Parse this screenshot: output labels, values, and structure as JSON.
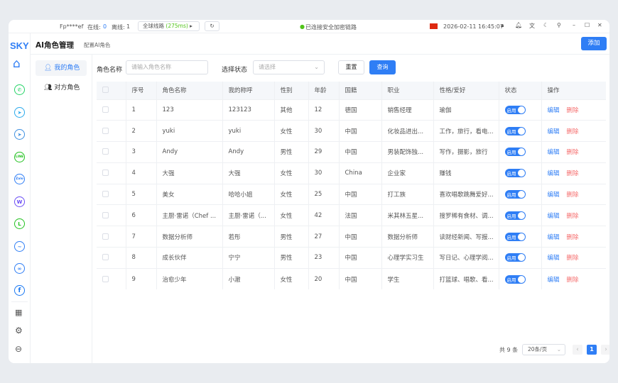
{
  "topbar": {
    "fingerprint": "Fp****ef",
    "online_label": "在线:",
    "online_count": "0",
    "offline_label": "离线:",
    "offline_count": "1",
    "route_label": "全球线路",
    "route_latency": "(275ms)",
    "connection_status": "已连接安全加密链路",
    "datetime": "2026-02-11 16:45:07"
  },
  "sidebar": {
    "logo": "SKY",
    "apps": [
      "home",
      "whatsapp",
      "telegram",
      "telegram-x",
      "line",
      "zalo",
      "w-app",
      "line-lite",
      "messenger",
      "meta",
      "facebook"
    ],
    "bottom": [
      "apps",
      "settings",
      "logout"
    ]
  },
  "header": {
    "title": "AI角色管理",
    "subtitle": "配置AI角色",
    "add_label": "添加"
  },
  "subnav": [
    {
      "label": "我的角色",
      "active": true
    },
    {
      "label": "对方角色",
      "active": false
    }
  ],
  "filters": {
    "name_label": "角色名称",
    "name_placeholder": "请输入角色名称",
    "status_label": "选择状态",
    "status_placeholder": "请选择",
    "reset_label": "重置",
    "query_label": "查询"
  },
  "table": {
    "columns": [
      "序号",
      "角色名称",
      "我的称呼",
      "性别",
      "年龄",
      "国籍",
      "职业",
      "性格/爱好",
      "状态",
      "操作"
    ],
    "rows": [
      [
        "1",
        "123",
        "123123",
        "其他",
        "12",
        "德国",
        "销售经理",
        "瑜伽"
      ],
      [
        "2",
        "yuki",
        "yuki",
        "女性",
        "30",
        "中国",
        "化妆品进出...",
        "工作，旅行，看电..."
      ],
      [
        "3",
        "Andy",
        "Andy",
        "男性",
        "29",
        "中国",
        "男装配饰独...",
        "写作，摄影，旅行"
      ],
      [
        "4",
        "大强",
        "大强",
        "女性",
        "30",
        "China",
        "企业家",
        "赚钱"
      ],
      [
        "5",
        "美女",
        "哈哈小姐",
        "女性",
        "25",
        "中国",
        "打工族",
        "喜欢唱歌跳舞爱好..."
      ],
      [
        "6",
        "主厨·雷诺（Chef ...",
        "主厨·雷诺（...",
        "女性",
        "42",
        "法国",
        "米其林五星...",
        "搜罗稀有食材、调..."
      ],
      [
        "7",
        "数据分析师",
        "若彤",
        "男性",
        "27",
        "中国",
        "数据分析师",
        "读财经新闻、写报..."
      ],
      [
        "8",
        "成长伙伴",
        "宁宁",
        "男性",
        "23",
        "中国",
        "心理学实习生",
        "写日记、心理学阅..."
      ],
      [
        "9",
        "治愈少年",
        "小澈",
        "女性",
        "20",
        "中国",
        "学生",
        "打篮球、唱歌、看..."
      ]
    ],
    "status_label": "启用",
    "edit_label": "编辑",
    "delete_label": "删除"
  },
  "pagination": {
    "total": "共 9 条",
    "page_size": "20条/页",
    "current_page": "1"
  },
  "colors": {
    "accent": "#2f7ef5",
    "danger": "#f56c6c"
  }
}
